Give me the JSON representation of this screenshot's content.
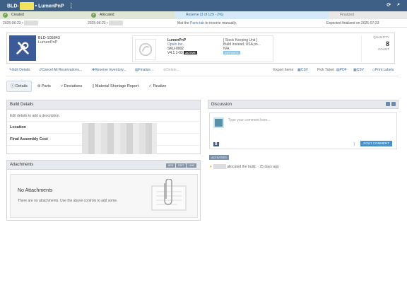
{
  "topbar": {
    "build_prefix": "BLD-",
    "title": "• LumenPnP",
    "menu_glyph": "⋮",
    "icon_refresh": "refresh-icon",
    "icon_search": "search-icon"
  },
  "stages": [
    {
      "label": "Created",
      "done": true
    },
    {
      "label": "Allocated",
      "done": true
    },
    {
      "label": "Reserve (3 of 129 - 2%)",
      "done": false
    },
    {
      "label": "Finalized",
      "done": false
    }
  ],
  "dates": {
    "created": "2025-06-23 •",
    "allocated": "2025-06-23 •",
    "reserve_note_prefix": "Mat the ",
    "reserve_note_link": "Parts tab",
    "reserve_note_suffix": " to reserve manually.",
    "finalized": "Expected finalized on 2025-07-23"
  },
  "build": {
    "id": "BLD-105843",
    "name": "LumenPnP",
    "logo_icon": "wrench-screwdriver-icon"
  },
  "part": {
    "name": "LumenPnP",
    "company": "Opulo Inc.",
    "sku": "SKU-0002",
    "version": "V4.1.1-03",
    "status": "ACTIVE",
    "stock_unit": "[ Stock Keeping Unit ]",
    "location": "Build Instead, USA po...",
    "na": "N/A",
    "inst_badge": "INSTANCE",
    "thumb_icon": "opulo-logo-icon"
  },
  "quantity": {
    "label": "QUANTITY",
    "value": "8",
    "unit": "COUNT"
  },
  "actions": {
    "edit": "Edit Details",
    "cancel": "Cancel All Reservations...",
    "reserve": "Reserve Inventory...",
    "finalize": "Finalize...",
    "delete": "Delete...",
    "export": "Export Items",
    "csv1": "CSV",
    "pick": "Pick Ticket",
    "pdf": "PDF",
    "csv2": "CSV",
    "print": "Print Labels"
  },
  "tabs": [
    "Details",
    "Parts",
    "Deviations",
    "Material Shortage Report",
    "Finalize"
  ],
  "build_details": {
    "title": "Build Details",
    "desc_placeholder": "Edit details to add a description.",
    "location_label": "Location",
    "cost_label": "Final Assembly Cost"
  },
  "attachments": {
    "title": "Attachments",
    "controls": [
      "ADD",
      "EDIT",
      "LINK"
    ],
    "empty_title": "No Attachments",
    "empty_sub": "There are no attachments. Use the above controls to add some."
  },
  "discussion": {
    "title": "Discussion",
    "placeholder": "Type your comment here...",
    "bold_btn": "B",
    "post_btn": "POST COMMENT",
    "all_btn": "ACTIVITIES",
    "activity_suffix": "allocated the build. · 25 days ago"
  }
}
